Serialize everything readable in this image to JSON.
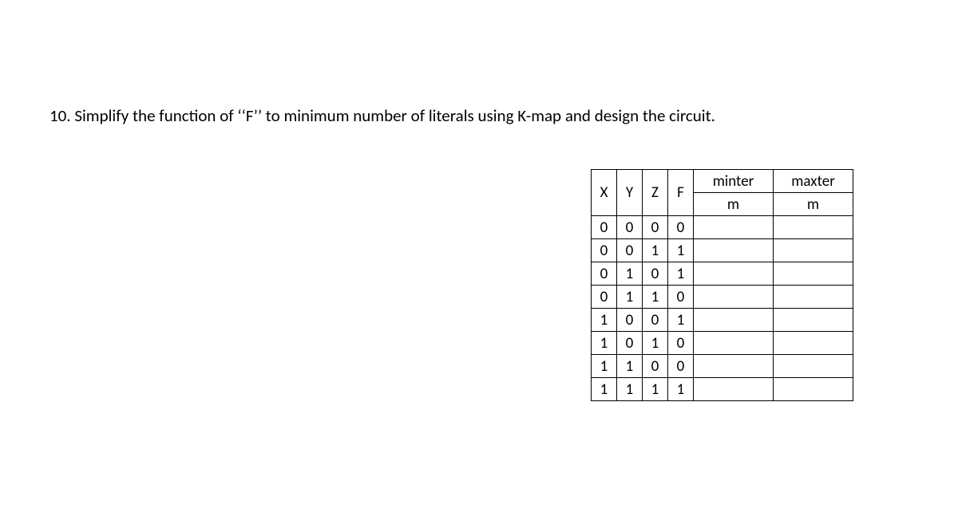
{
  "question": "10. Simplify the function of  ‘‘F’’ to minimum number of literals using K-map and design the circuit.",
  "headers": {
    "x": "X",
    "y": "Y",
    "z": "Z",
    "f": "F",
    "minterm_top": "minter",
    "minterm_bot": "m",
    "maxterm_top": "maxter",
    "maxterm_bot": "m"
  },
  "rows": [
    {
      "x": "0",
      "y": "0",
      "z": "0",
      "f": "0",
      "min": "",
      "max": ""
    },
    {
      "x": "0",
      "y": "0",
      "z": "1",
      "f": "1",
      "min": "",
      "max": ""
    },
    {
      "x": "0",
      "y": "1",
      "z": "0",
      "f": "1",
      "min": "",
      "max": ""
    },
    {
      "x": "0",
      "y": "1",
      "z": "1",
      "f": "0",
      "min": "",
      "max": ""
    },
    {
      "x": "1",
      "y": "0",
      "z": "0",
      "f": "1",
      "min": "",
      "max": ""
    },
    {
      "x": "1",
      "y": "0",
      "z": "1",
      "f": "0",
      "min": "",
      "max": ""
    },
    {
      "x": "1",
      "y": "1",
      "z": "0",
      "f": "0",
      "min": "",
      "max": ""
    },
    {
      "x": "1",
      "y": "1",
      "z": "1",
      "f": "1",
      "min": "",
      "max": ""
    }
  ]
}
